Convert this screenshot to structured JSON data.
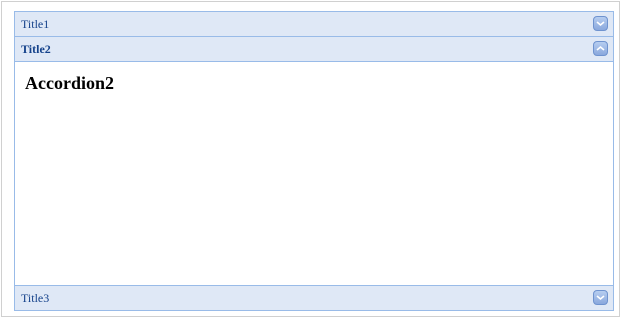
{
  "accordion": {
    "panels": [
      {
        "title": "Title1",
        "expanded": false,
        "toggle_icon": "chevron-down-icon"
      },
      {
        "title": "Title2",
        "expanded": true,
        "toggle_icon": "chevron-up-icon",
        "content_heading": "Accordion2"
      },
      {
        "title": "Title3",
        "expanded": false,
        "toggle_icon": "chevron-down-icon"
      }
    ]
  },
  "colors": {
    "header_bg": "#dfe8f6",
    "border": "#99bbe8",
    "title_text": "#15428b"
  }
}
